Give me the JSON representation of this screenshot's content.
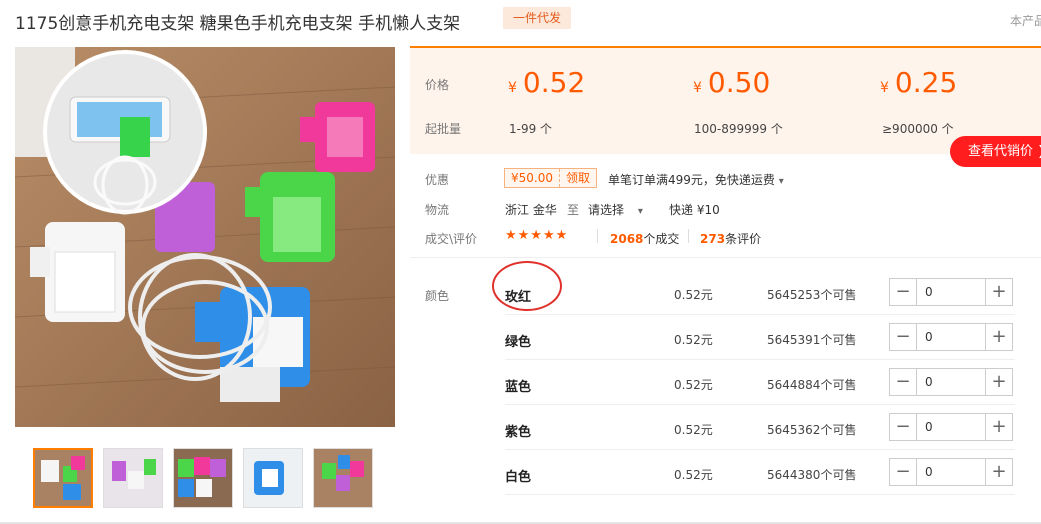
{
  "header": {
    "title": "1175创意手机充电支架 糖果色手机充电支架 手机懒人支架",
    "badge": "一件代发",
    "corner_text": "本产品"
  },
  "pricing": {
    "price_label": "价格",
    "moq_label": "起批量",
    "currency": "¥",
    "tiers": [
      {
        "price": "0.52",
        "range": "1-99 个"
      },
      {
        "price": "0.50",
        "range": "100-899999 个"
      },
      {
        "price": "0.25",
        "range": "≥900000 个"
      }
    ],
    "agent_price_button": "查看代销价"
  },
  "info": {
    "discount_label": "优惠",
    "coupon_amount": "¥50.00",
    "coupon_action": "领取",
    "free_shipping": "单笔订单满499元，免快递运费",
    "logistics_label": "物流",
    "origin": "浙江 金华",
    "to": "至",
    "destination": "请选择",
    "delivery": "快递 ¥10",
    "deals_label": "成交\\评价",
    "rating_stars": 5,
    "deals_count": "2068",
    "deals_suffix": "个成交",
    "reviews_count": "273",
    "reviews_suffix": "条评价"
  },
  "sku": {
    "color_label": "颜色",
    "items": [
      {
        "name": "玫红",
        "price": "0.52元",
        "stock": "5645253个可售",
        "qty": "0"
      },
      {
        "name": "绿色",
        "price": "0.52元",
        "stock": "5645391个可售",
        "qty": "0"
      },
      {
        "name": "蓝色",
        "price": "0.52元",
        "stock": "5644884个可售",
        "qty": "0"
      },
      {
        "name": "紫色",
        "price": "0.52元",
        "stock": "5645362个可售",
        "qty": "0"
      },
      {
        "name": "白色",
        "price": "0.52元",
        "stock": "5644380个可售",
        "qty": "0"
      }
    ]
  },
  "colors": {
    "accent": "#ff5a00",
    "price_bg": "#fff4ec",
    "button_red": "#ff1d1d",
    "highlight_circle": "#e0322b"
  }
}
